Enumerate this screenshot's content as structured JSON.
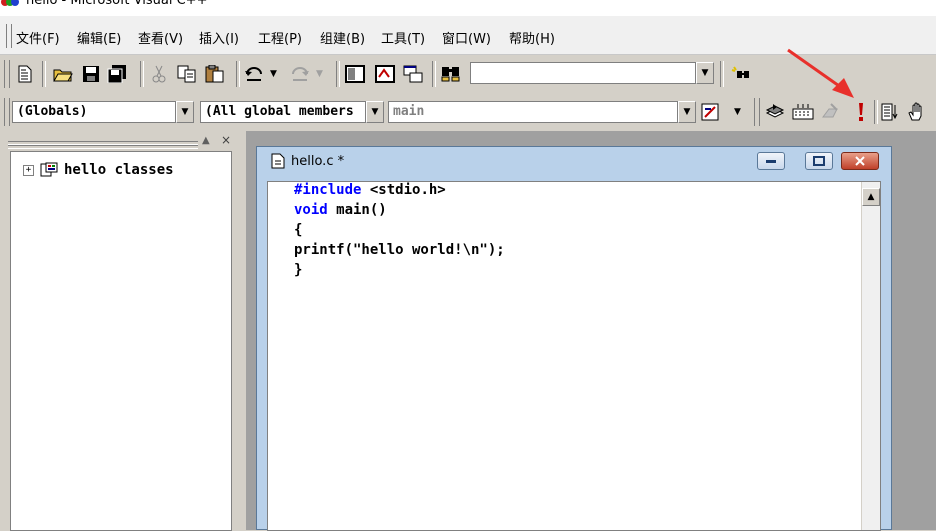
{
  "window": {
    "title": "hello - Microsoft Visual C++"
  },
  "menu": [
    "文件(F)",
    "编辑(E)",
    "查看(V)",
    "插入(I)",
    "工程(P)",
    "组建(B)",
    "工具(T)",
    "窗口(W)",
    "帮助(H)"
  ],
  "toolbar": {
    "find_combo_value": "",
    "icons": [
      "new-file-icon",
      "open-folder-icon",
      "save-icon",
      "save-all-icon",
      "cut-icon",
      "copy-icon",
      "paste-icon",
      "undo-icon",
      "redo-icon",
      "workspace-icon",
      "output-icon",
      "window-list-icon",
      "find-in-files-icon",
      "search-icon"
    ],
    "wizard": {
      "globals_combo": "(Globals)",
      "members_combo": "(All global members",
      "function_combo": "main"
    },
    "build_icons": [
      "compile-icon",
      "build-icon",
      "stop-build-icon",
      "execute-icon",
      "go-icon",
      "breakpoint-hand-icon"
    ]
  },
  "workspace": {
    "tree_root": "hello classes"
  },
  "document": {
    "title": "hello.c *",
    "code": {
      "line1_kw": "#include",
      "line1_rest": " <stdio.h>",
      "line2_kw": "void",
      "line2_rest": " main()",
      "line3": "{",
      "line4": "printf(\"hello world!\\n\");",
      "line5": "}"
    }
  },
  "annotation": {
    "arrow_color": "#e8302b",
    "target": "execute-icon"
  }
}
